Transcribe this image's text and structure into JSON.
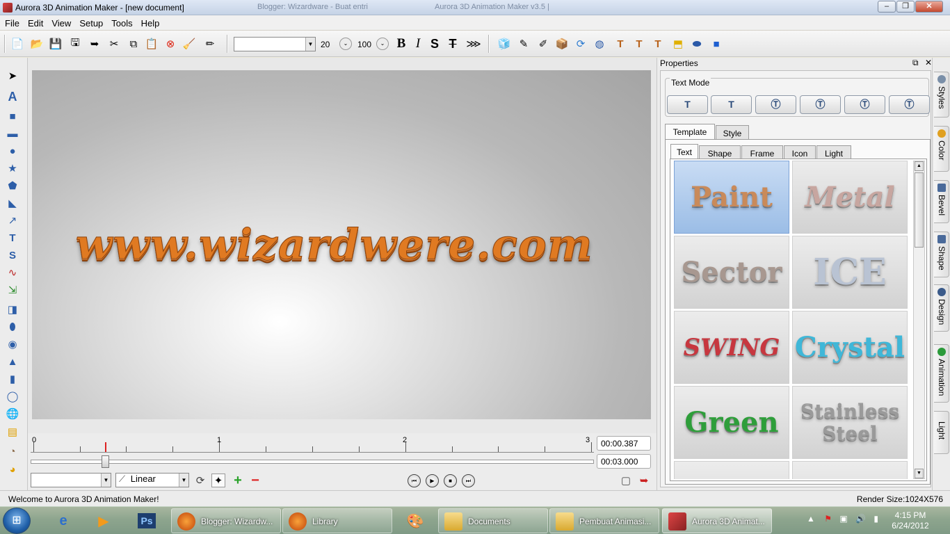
{
  "window": {
    "title": "Aurora 3D Animation Maker - [new document]",
    "ghost_tabs": [
      "Blogger: Wizardware - Buat entri",
      "Aurora 3D Animation Maker v3.5 |"
    ]
  },
  "menu": [
    "File",
    "Edit",
    "View",
    "Setup",
    "Tools",
    "Help"
  ],
  "toolbar": {
    "font_select": "",
    "font_size": "20",
    "font_scale": "100",
    "bold_label": "B",
    "italic_label": "I",
    "shadow_label": "S",
    "strike_label": "T"
  },
  "canvas": {
    "text": "www.wizardwere.com",
    "text_color": "#e07a22"
  },
  "timeline": {
    "ruler_labels": [
      "0",
      "1",
      "2",
      "3"
    ],
    "current_time": "00:00.387",
    "total_time": "00:03.000",
    "progress": 0.129,
    "interpolation": "Linear",
    "layer_select": ""
  },
  "properties": {
    "title": "Properties",
    "text_mode_label": "Text Mode",
    "main_tabs": [
      "Template",
      "Style"
    ],
    "sub_tabs": [
      "Text",
      "Shape",
      "Frame",
      "Icon",
      "Light"
    ],
    "templates": [
      {
        "label": "Paint",
        "color": "#c98a5a"
      },
      {
        "label": "Metal",
        "color": "#c7a6a0"
      },
      {
        "label": "Sector",
        "color": "#a89890"
      },
      {
        "label": "ICE",
        "color": "#b9c3d3"
      },
      {
        "label": "SWING",
        "color": "#c7373f"
      },
      {
        "label": "Crystal",
        "color": "#3fb7d8"
      },
      {
        "label": "Green",
        "color": "#2e9e3a"
      },
      {
        "label": "Stainless Steel",
        "color": "#9a9a9a"
      }
    ]
  },
  "side_tabs": [
    "Styles",
    "Color",
    "Bevel",
    "Shape",
    "Design",
    "Animation",
    "Light"
  ],
  "status": {
    "message": "Welcome to Aurora 3D Animation Maker!",
    "render_size": "Render Size:1024X576"
  },
  "taskbar": {
    "tasks": [
      "Blogger: Wizardw...",
      "Library",
      "Documents",
      "Pembuat Animasi...",
      "Aurora 3D Animat..."
    ],
    "time": "4:15 PM",
    "date": "6/24/2012"
  }
}
